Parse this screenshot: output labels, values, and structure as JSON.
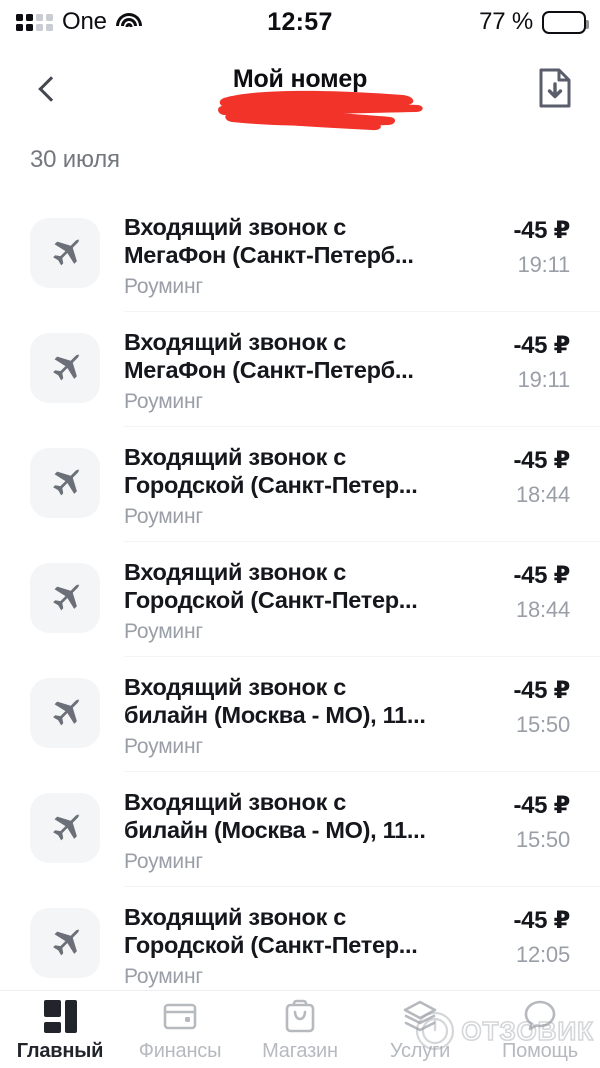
{
  "statusbar": {
    "carrier": "One",
    "time": "12:57",
    "battery_percent": "77 %",
    "battery_level": 77,
    "signal_icon": "signal-bars-icon",
    "wifi_icon": "wifi-icon",
    "battery_icon": "battery-icon"
  },
  "header": {
    "title": "Мой номер",
    "back_icon": "back-chevron-icon",
    "download_icon": "download-document-icon",
    "redaction_color": "#F1332A",
    "redaction_note": "red-scribble-redaction"
  },
  "date_section": {
    "label": "30 июля"
  },
  "list": {
    "row_icon": "airplane-icon",
    "items": [
      {
        "title": "Входящий звонок с МегаФон (Санкт-Петерб...",
        "subtitle": "Роуминг",
        "amount": "-45 ₽",
        "time": "19:11"
      },
      {
        "title": "Входящий звонок с МегаФон (Санкт-Петерб...",
        "subtitle": "Роуминг",
        "amount": "-45 ₽",
        "time": "19:11"
      },
      {
        "title": "Входящий звонок с Городской (Санкт-Петер...",
        "subtitle": "Роуминг",
        "amount": "-45 ₽",
        "time": "18:44"
      },
      {
        "title": "Входящий звонок с Городской (Санкт-Петер...",
        "subtitle": "Роуминг",
        "amount": "-45 ₽",
        "time": "18:44"
      },
      {
        "title": "Входящий звонок с билайн (Москва - МО), 11...",
        "subtitle": "Роуминг",
        "amount": "-45 ₽",
        "time": "15:50"
      },
      {
        "title": "Входящий звонок с билайн (Москва - МО), 11...",
        "subtitle": "Роуминг",
        "amount": "-45 ₽",
        "time": "15:50"
      },
      {
        "title": "Входящий звонок с Городской (Санкт-Петер...",
        "subtitle": "Роуминг",
        "amount": "-45 ₽",
        "time": "12:05"
      }
    ]
  },
  "tabbar": {
    "active_color": "#22242B",
    "inactive_color": "#B6BABF",
    "items": [
      {
        "label": "Главный",
        "icon": "grid-icon",
        "active": true
      },
      {
        "label": "Финансы",
        "icon": "wallet-icon",
        "active": false
      },
      {
        "label": "Магазин",
        "icon": "shopping-bag-icon",
        "active": false
      },
      {
        "label": "Услуги",
        "icon": "layers-icon",
        "active": false
      },
      {
        "label": "Помощь",
        "icon": "speech-bubble-icon",
        "active": false
      }
    ]
  },
  "watermark": {
    "text": "ОТЗОВИК",
    "logo_icon": "otzovik-logo-icon"
  }
}
